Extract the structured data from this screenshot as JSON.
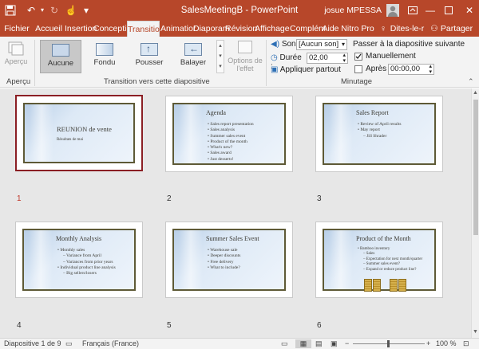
{
  "title_bar": {
    "title": "SalesMeetingB - PowerPoint",
    "user": "josue MPESSA"
  },
  "tabs": [
    "Fichier",
    "Accueil",
    "Insertion",
    "Conceptio",
    "Transition",
    "Animatior",
    "Diaporam",
    "Révision",
    "Affichage",
    "Complém",
    "Aide",
    "Nitro Pro",
    "Dites-le-r"
  ],
  "share_label": "Partager",
  "ribbon": {
    "preview_label": "Aperçu",
    "preview_group": "Aperçu",
    "transitions": [
      "Aucune",
      "Fondu",
      "Pousser",
      "Balayer"
    ],
    "effect_options": "Options de l'effet",
    "group_transition": "Transition vers cette diapositive",
    "sound_label": "Son :",
    "sound_value": "[Aucun son]",
    "duration_label": "Durée :",
    "duration_value": "02,00",
    "apply_all": "Appliquer partout",
    "advance_label": "Passer à la diapositive suivante",
    "manually_label": "Manuellement",
    "after_label": "Après :",
    "after_value": "00:00,00",
    "group_timing": "Minutage"
  },
  "slides": [
    {
      "num": "1",
      "title": "REUNION de vente",
      "subtitle": "Résultats de mai"
    },
    {
      "num": "2",
      "title": "Agenda",
      "bullets": [
        "Sales report presentation",
        "Sales analysis",
        "Summer sales event",
        "Product of the month",
        "What's new?",
        "Sales award",
        "Just desserts!"
      ]
    },
    {
      "num": "3",
      "title": "Sales Report",
      "bullets": [
        "Review of April results",
        "May report"
      ],
      "sub": [
        "Jill Shrader"
      ]
    },
    {
      "num": "4",
      "title": "Monthly Analysis",
      "bullets": [
        "Monthly sales",
        "Individual product line analysis"
      ],
      "sub1": [
        "Variance from April",
        "Variances from prior years"
      ],
      "sub2": [
        "Big sellers/losers"
      ]
    },
    {
      "num": "5",
      "title": "Summer Sales Event",
      "bullets": [
        "Warehouse sale",
        "Deeper discounts",
        "Free delivery",
        "What to include?"
      ]
    },
    {
      "num": "6",
      "title": "Product of the Month",
      "bullets": [
        "Bamboo inventory"
      ],
      "sub": [
        "Sales",
        "Expectation for next month/quarter",
        "Summer sales event?",
        "Expand or reduce product line?"
      ]
    }
  ],
  "status": {
    "slide_info": "Diapositive 1 de 9",
    "language": "Français (France)",
    "zoom": "100 %"
  }
}
